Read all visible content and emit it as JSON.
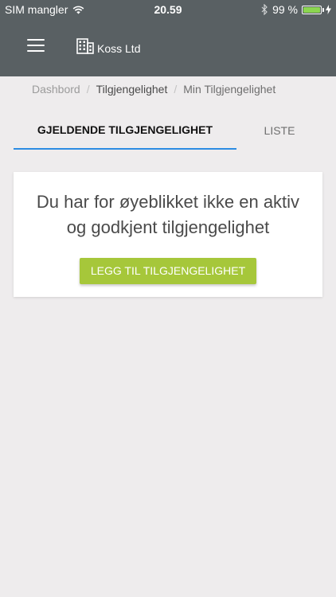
{
  "status_bar": {
    "carrier": "SIM mangler",
    "time": "20.59",
    "battery": "99 %",
    "battery_level": 0.99,
    "icons": [
      "wifi-icon",
      "bluetooth-icon",
      "battery-icon",
      "charging-icon"
    ]
  },
  "app_bar": {
    "menu_icon": "hamburger-menu-icon",
    "brand_icon": "building-icon",
    "brand_name": "Koss Ltd"
  },
  "breadcrumb": {
    "items": [
      "Dashbord",
      "Tilgjengelighet",
      "Min Tilgjengelighet"
    ],
    "separator": "/"
  },
  "tabs": [
    {
      "label": "GJELDENDE TILGJENGELIGHET",
      "active": true
    },
    {
      "label": "LISTE",
      "active": false
    }
  ],
  "card": {
    "message": "Du har for øyeblikket ikke en aktiv og godkjent tilgjengelighet",
    "button_label": "LEGG TIL TILGJENGELIGHET"
  },
  "colors": {
    "header": "#596063",
    "tab_indicator": "#2c8ce3",
    "button": "#a6c73a",
    "background": "#eeeced"
  }
}
